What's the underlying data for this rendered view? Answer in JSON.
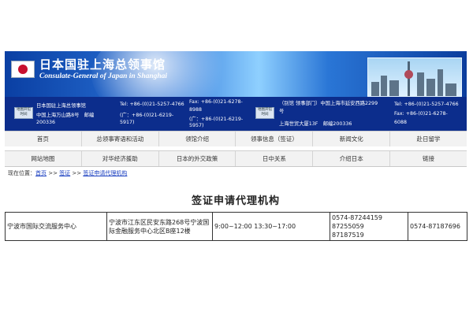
{
  "header": {
    "title_cn": "日本国驻上海总领事馆",
    "title_en": "Consulate-General of Japan in Shanghai"
  },
  "contact": {
    "left": {
      "line1": "日本国驻上海总领事馆",
      "line2": "中国上海万山路8号　邮编",
      "zip": "200336",
      "map_button": "地图开馆时间",
      "tel": "Tel: +86-(0)21-5257-4766",
      "fax1": "Fax: +86-(0)21-6278-",
      "fax2": "8988",
      "guang1": "(广：+86-(0)21-6219-",
      "guang2": "5917)",
      "fax_guang1": "(广：+86-(0)21-6219-",
      "fax_guang2": "5957)"
    },
    "right": {
      "line1": "（别馆 领事部门）中国上海市延安西路2299",
      "line1b": "号",
      "line2": "上海世贸大厦13F　邮编200336",
      "map_button": "地图开馆时间",
      "tel": "Tel: +86-(0)21-5257-4766",
      "fax1": "Fax: +86-(0)21-6278-",
      "fax2": "6088"
    }
  },
  "nav": {
    "row1": [
      "首页",
      "总领事寄语和活动",
      "领馆介绍",
      "领事信息（签证）",
      "新闻文化",
      "赴日留学"
    ],
    "row2": [
      "网站地图",
      "对华经济援助",
      "日本的外交政策",
      "日中关系",
      "介绍日本",
      "链接"
    ]
  },
  "breadcrumb": {
    "prefix": "现在位置：",
    "home": "首页",
    "sep1": " >> ",
    "visa": "签证",
    "sep2": " >> ",
    "current": "签证申请代理机构"
  },
  "page_title": "签证申请代理机构",
  "table": {
    "rows": [
      {
        "name": "宁波市国际交流服务中心",
        "address": "宁波市江东区民安东路268号宁波国际金融服务中心北区B座12楼",
        "hours": "9:00~12:00 13:30~17:00",
        "phone1": "0574-87244159",
        "phone2": "87255059",
        "phone3": "87187519",
        "fax": "0574-87187696"
      }
    ]
  },
  "colors": {
    "banner_blue": "#0a3fa3",
    "contact_bar": "#0c2d8c",
    "link": "#1a3fc0"
  }
}
